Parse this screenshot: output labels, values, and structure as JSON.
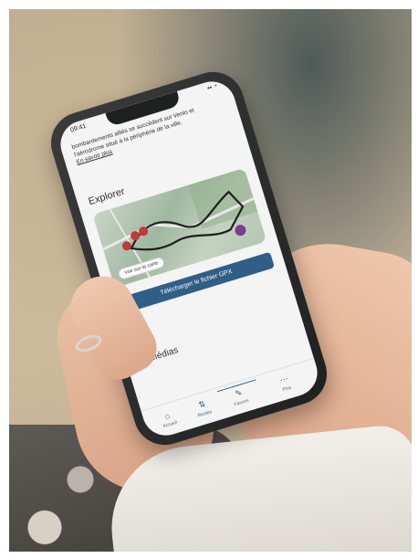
{
  "phone_screen": {
    "status": {
      "time": "09:41",
      "icons": "▪▪ ◔"
    },
    "intro_text": "bombardements alliés se succèdent sur Venlo et l'aérodrome situé à la périphérie de la ville.",
    "read_more": "En savoir plus",
    "explore_title": "Explorer",
    "map_button": "Voir sur la carte",
    "gpx_button": "Télécharger le fichier GPX",
    "media_title": "Médias",
    "tabs": [
      {
        "label": "Accueil",
        "icon": "home-icon"
      },
      {
        "label": "Routes",
        "icon": "routes-icon"
      },
      {
        "label": "Favoris",
        "icon": "pin-icon"
      },
      {
        "label": "Plus",
        "icon": "more-icon"
      }
    ]
  },
  "colors": {
    "accent": "#2f5e86",
    "screen_bg": "#f4f4f4",
    "route": "#1e1e1e",
    "marker": "#c0393c"
  }
}
